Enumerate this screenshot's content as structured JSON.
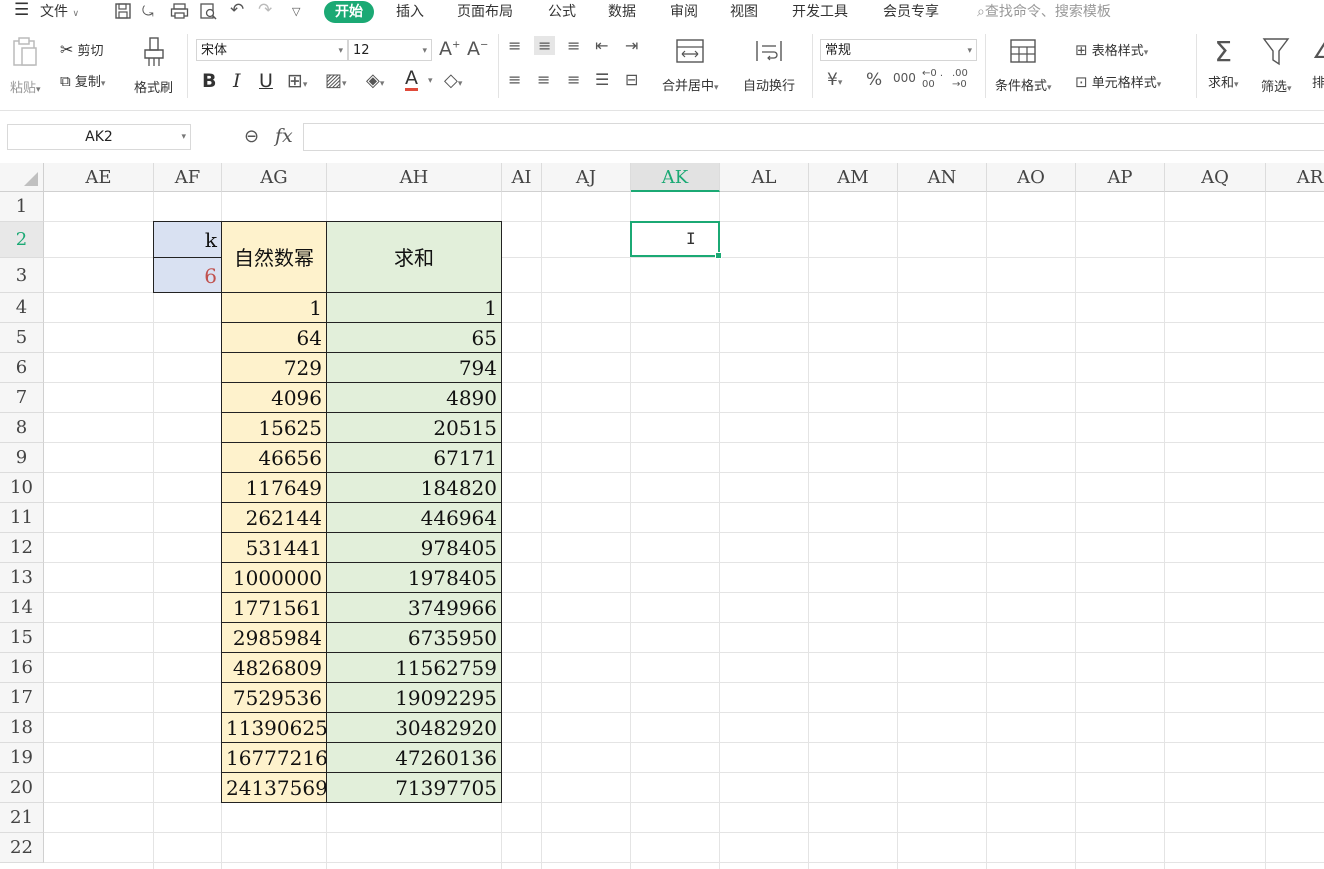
{
  "menu": {
    "file_label": "文件",
    "tabs": [
      "开始",
      "插入",
      "页面布局",
      "公式",
      "数据",
      "审阅",
      "视图",
      "开发工具",
      "会员专享"
    ],
    "search_placeholder": "查找命令、搜索模板"
  },
  "ribbon": {
    "paste": "粘贴",
    "cut": "剪切",
    "copy": "复制",
    "format_painter": "格式刷",
    "font_name": "宋体",
    "font_size": "12",
    "merge_center": "合并居中",
    "wrap_text": "自动换行",
    "number_format": "常规",
    "currency_symbol": "¥",
    "percent_symbol": "%",
    "thousands_symbol": "000",
    "dec_increase": "←0 .00",
    "dec_decrease": ".00 →0",
    "conditional_format": "条件格式",
    "table_style": "表格样式",
    "cell_style": "单元格样式",
    "sum": "求和",
    "filter": "筛选",
    "sort": "排"
  },
  "formula_bar": {
    "name_box": "AK2",
    "fx_label": "fx",
    "formula": ""
  },
  "sheet": {
    "columns": [
      "AE",
      "AF",
      "AG",
      "AH",
      "AI",
      "AJ",
      "AK",
      "AL",
      "AM",
      "AN",
      "AO",
      "AP",
      "AQ",
      "AR"
    ],
    "active_column": "AK",
    "rows": [
      "1",
      "2",
      "3",
      "4",
      "5",
      "6",
      "7",
      "8",
      "9",
      "10",
      "11",
      "12",
      "13",
      "14",
      "15",
      "16",
      "17",
      "18",
      "19",
      "20",
      "21",
      "22"
    ],
    "active_row": "2",
    "k_label": "k",
    "k_value": "6",
    "header_ag": "自然数幂",
    "header_ah": "求和",
    "ag_values": [
      "1",
      "64",
      "729",
      "4096",
      "15625",
      "46656",
      "117649",
      "262144",
      "531441",
      "1000000",
      "1771561",
      "2985984",
      "4826809",
      "7529536",
      "11390625",
      "16777216",
      "24137569"
    ],
    "ah_values": [
      "1",
      "65",
      "794",
      "4890",
      "20515",
      "67171",
      "184820",
      "446964",
      "978405",
      "1978405",
      "3749966",
      "6735950",
      "11562759",
      "19092295",
      "30482920",
      "47260136",
      "71397705"
    ]
  },
  "colors": {
    "accent": "#1ba974",
    "ag_fill": "#fef2cc",
    "ah_fill": "#e2efda",
    "af_fill": "#d9e1f2",
    "k_value_color": "#c0504d"
  }
}
